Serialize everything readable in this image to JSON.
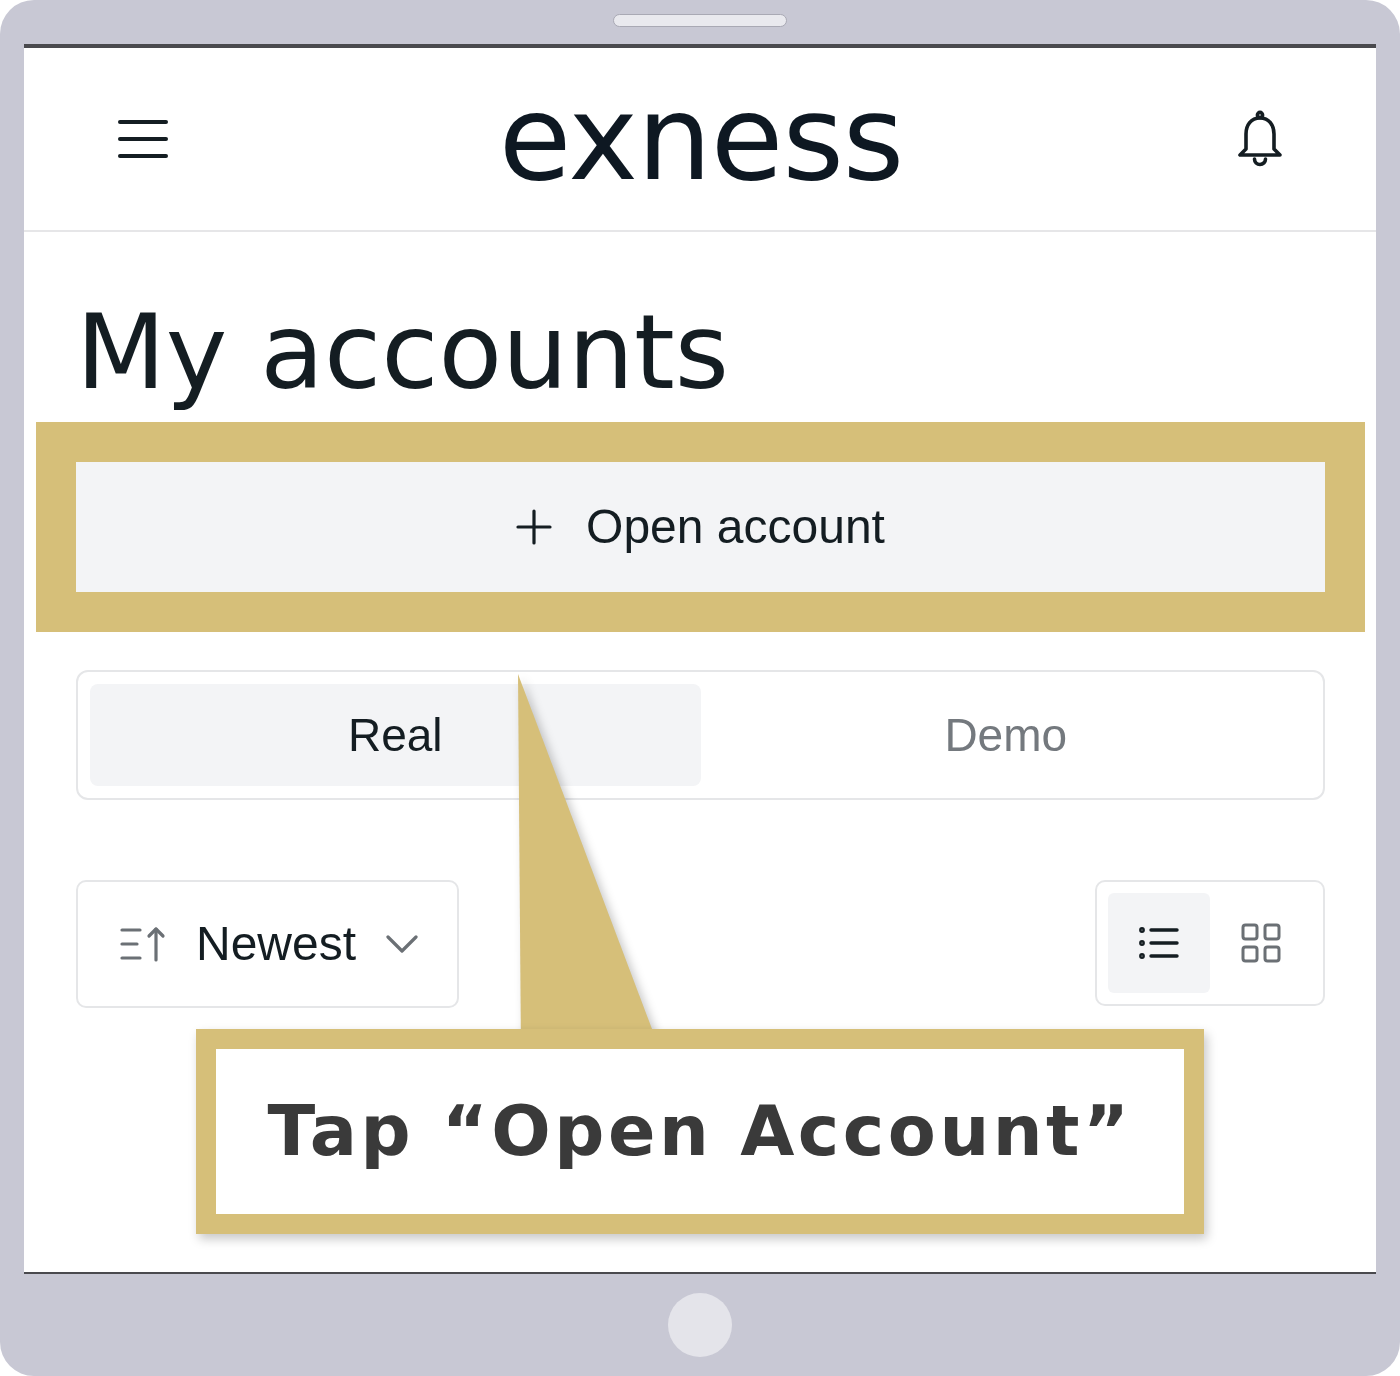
{
  "header": {
    "logo": "exness"
  },
  "page": {
    "title": "My accounts"
  },
  "open_account_button": {
    "label": "Open account",
    "highlighted": true
  },
  "account_tabs": [
    {
      "label": "Real",
      "selected": true
    },
    {
      "label": "Demo",
      "selected": false
    }
  ],
  "sort": {
    "label": "Newest"
  },
  "view_modes": [
    {
      "kind": "list",
      "selected": true
    },
    {
      "kind": "grid",
      "selected": false
    }
  ],
  "callout": {
    "text": "Tap “Open Account”"
  }
}
